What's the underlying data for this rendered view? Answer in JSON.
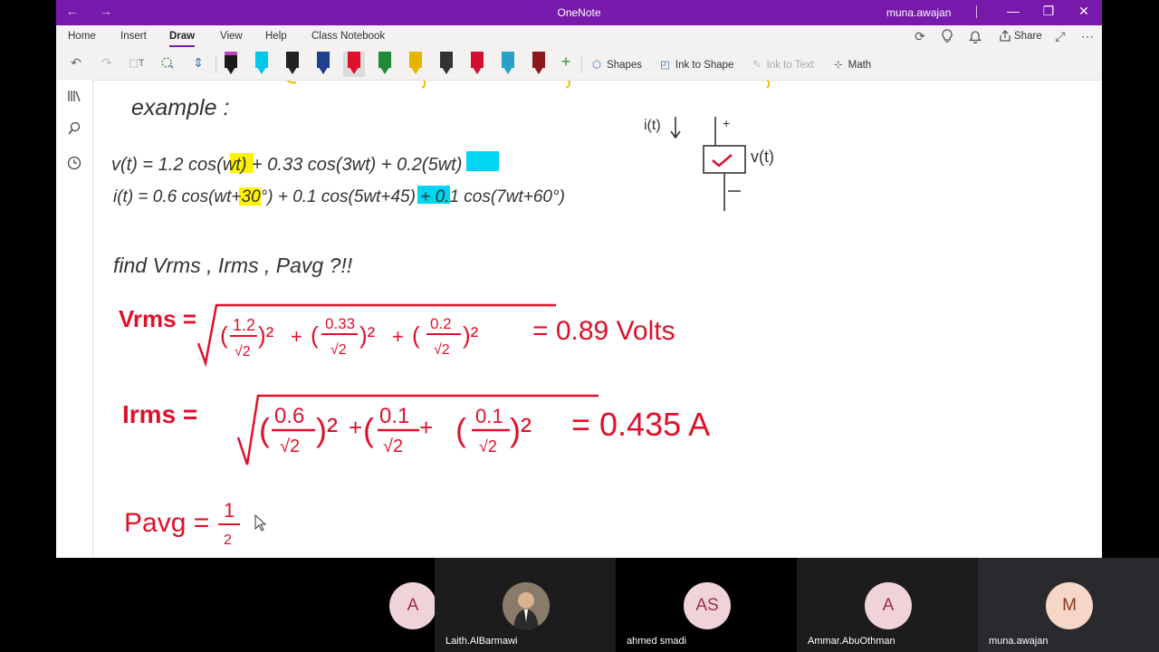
{
  "window": {
    "title": "OneNote",
    "user": "muna.awajan",
    "nav_back": "←",
    "nav_forward": "→",
    "controls": {
      "minimize": "—",
      "restore": "❐",
      "close": "✕"
    }
  },
  "menu": {
    "tabs": [
      "Home",
      "Insert",
      "Draw",
      "View",
      "Help",
      "Class Notebook"
    ],
    "active": "Draw",
    "share_label": "Share",
    "right_icons": [
      "sync-icon",
      "lightbulb-icon",
      "bell-icon",
      "share-icon",
      "expand-icon",
      "more-icon"
    ]
  },
  "toolbar": {
    "icons": [
      "undo-icon",
      "redo-icon",
      "lasso-select-icon",
      "eraser-icon",
      "add-space-icon"
    ],
    "pens": [
      {
        "name": "pencil-black",
        "color": "#1a1a1a",
        "top": "#c040c0"
      },
      {
        "name": "highlighter-cyan",
        "color": "#00c8e8",
        "top": "#00c8e8"
      },
      {
        "name": "pen-black",
        "color": "#222222",
        "top": "#222222"
      },
      {
        "name": "pen-navy",
        "color": "#1f3f8f",
        "top": "#1f3f8f"
      },
      {
        "name": "pen-red",
        "color": "#e0102a",
        "top": "#e0102a",
        "selected": true
      },
      {
        "name": "pen-green",
        "color": "#1f8a3a",
        "top": "#1f8a3a"
      },
      {
        "name": "pen-yellow",
        "color": "#e8b400",
        "top": "#e8b400"
      },
      {
        "name": "pen-galaxy",
        "color": "#333333",
        "top": "#333333"
      },
      {
        "name": "pen-red-2",
        "color": "#d01030",
        "top": "#d01030"
      },
      {
        "name": "pen-teal",
        "color": "#2aa0c8",
        "top": "#2aa0c8"
      },
      {
        "name": "pen-dark-red",
        "color": "#8a1a1a",
        "top": "#8a1a1a"
      }
    ],
    "tools": {
      "shapes": "Shapes",
      "ink_to_shape": "Ink to Shape",
      "ink_to_text": "Ink to Text",
      "math": "Math"
    }
  },
  "sidebar": {
    "icons": [
      "notebooks-icon",
      "search-icon",
      "recent-icon"
    ]
  },
  "notes": {
    "heading": "example :",
    "v_eq": [
      "v(t) = 1.2 cos(",
      "wt",
      ") + 0.33 cos(3wt) + 0.2(",
      "5wt",
      ")"
    ],
    "i_eq": [
      "i(t) = 0.6 cos(",
      "wt",
      "+30°) + 0.1 cos(",
      "5wt",
      "+45) + 0.1 cos(7wt+60°)"
    ],
    "find": "find Vrms , Irms , Pavg ?!!",
    "vrms_label": "Vrms =",
    "vrms_terms": [
      "1.2",
      "√2",
      "0.33",
      "√2",
      "0.2",
      "√2"
    ],
    "vrms_result": "= 0.89 Volts",
    "irms_label": "Irms =",
    "irms_terms": [
      "0.6",
      "√2",
      "0.1",
      "√2",
      "0.1",
      "√2"
    ],
    "irms_result": "= 0.435 A",
    "pavg_label": "Pavg =",
    "pavg_num": "1",
    "pavg_den": "2",
    "diagram": {
      "current": "i(t)",
      "voltage": "v(t)",
      "plus": "+",
      "minus": "−"
    }
  },
  "participants": [
    {
      "initials": "A",
      "name": ""
    },
    {
      "initials": "",
      "name": "Laith.AlBarmawi",
      "photo": true
    },
    {
      "initials": "AS",
      "name": "ahmed smadi"
    },
    {
      "initials": "A",
      "name": "Ammar.AbuOthman"
    },
    {
      "initials": "M",
      "name": "muna.awajan"
    }
  ]
}
